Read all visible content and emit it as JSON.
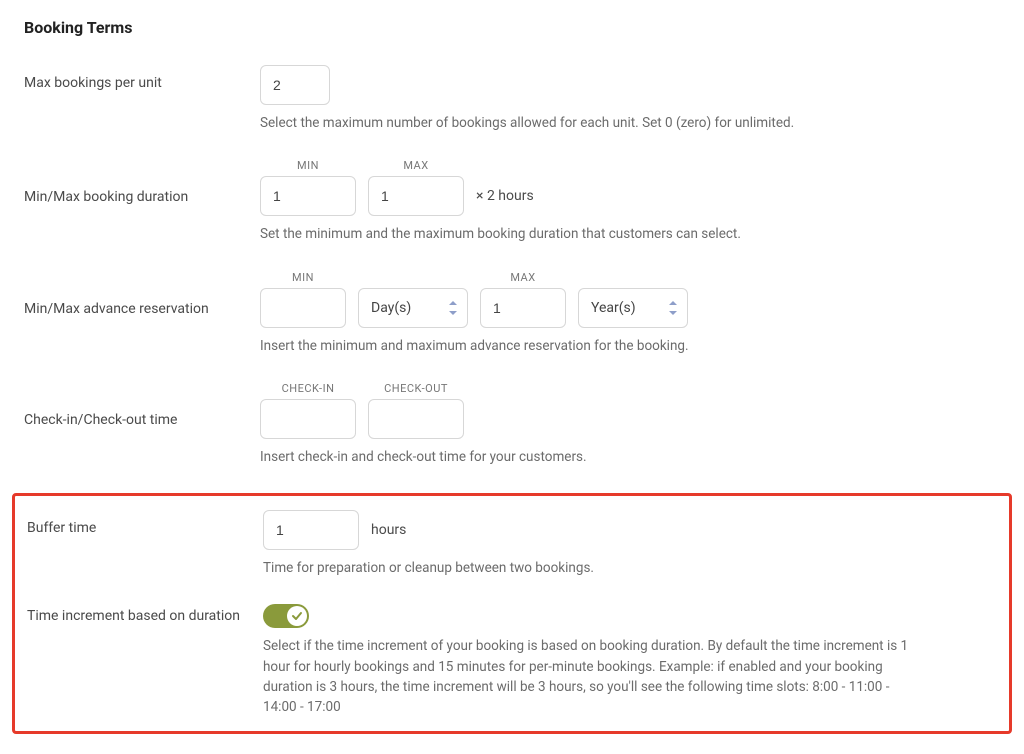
{
  "section_title": "Booking Terms",
  "maxBookings": {
    "label": "Max bookings per unit",
    "value": "2",
    "help": "Select the maximum number of bookings allowed for each unit. Set 0 (zero) for unlimited."
  },
  "duration": {
    "label": "Min/Max booking duration",
    "minHeader": "MIN",
    "maxHeader": "MAX",
    "minValue": "1",
    "maxValue": "1",
    "suffix": "× 2 hours",
    "help": "Set the minimum and the maximum booking duration that customers can select."
  },
  "advance": {
    "label": "Min/Max advance reservation",
    "minHeader": "MIN",
    "maxHeader": "MAX",
    "minValue": "",
    "minUnit": "Day(s)",
    "maxValue": "1",
    "maxUnit": "Year(s)",
    "help": "Insert the minimum and maximum advance reservation for the booking."
  },
  "checkTime": {
    "label": "Check-in/Check-out time",
    "inHeader": "CHECK-IN",
    "outHeader": "CHECK-OUT",
    "inValue": "",
    "outValue": "",
    "help": "Insert check-in and check-out time for your customers."
  },
  "buffer": {
    "label": "Buffer time",
    "value": "1",
    "unit": "hours",
    "help": "Time for preparation or cleanup between two bookings."
  },
  "timeIncrement": {
    "label": "Time increment based on duration",
    "enabled": true,
    "help": "Select if the time increment of your booking is based on booking duration. By default the time increment is 1 hour for hourly bookings and 15 minutes for per-minute bookings. Example: if enabled and your booking duration is 3 hours, the time increment will be 3 hours, so you'll see the following time slots: 8:00 - 11:00 - 14:00 - 17:00"
  }
}
